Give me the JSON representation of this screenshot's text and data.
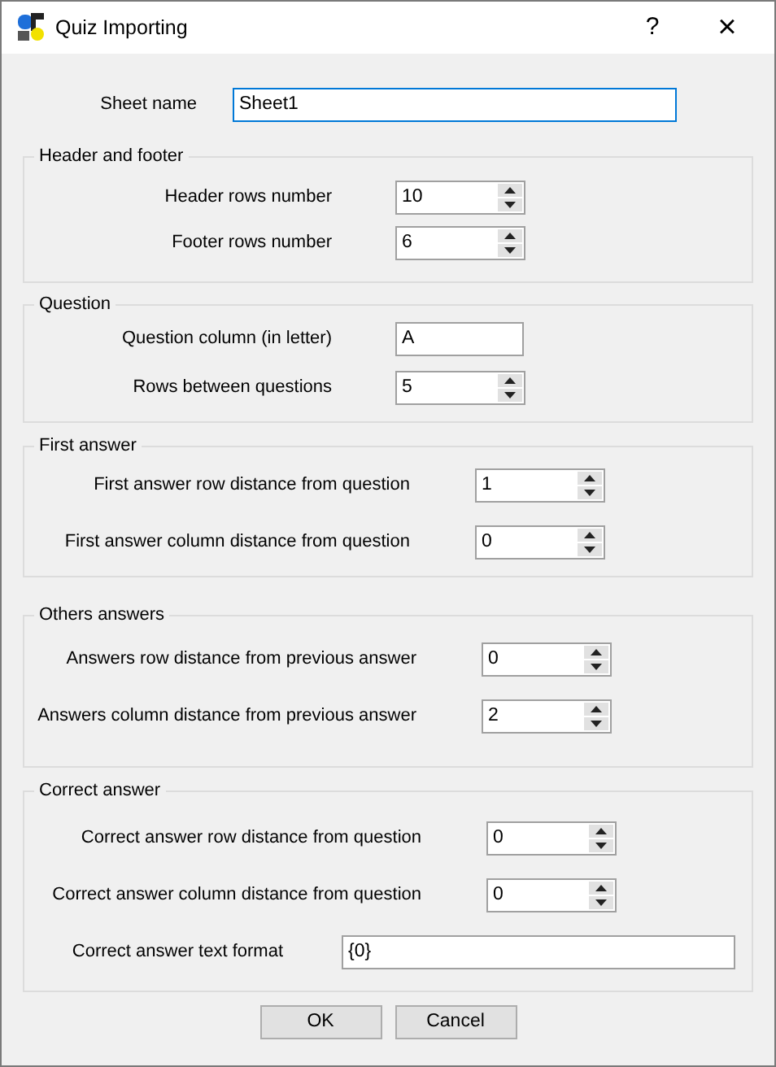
{
  "window": {
    "title": "Quiz Importing",
    "help": "?",
    "close": "×"
  },
  "sheet": {
    "label": "Sheet name",
    "value": "Sheet1",
    "focused": true
  },
  "groups": [
    {
      "title": "Header and footer",
      "fields": [
        {
          "kind": "spin",
          "label": "Header rows number",
          "value": "10"
        },
        {
          "kind": "spin",
          "label": "Footer rows number",
          "value": "6"
        }
      ]
    },
    {
      "title": "Question",
      "fields": [
        {
          "kind": "text",
          "label": "Question column (in letter)",
          "value": "A"
        },
        {
          "kind": "spin",
          "label": "Rows between questions",
          "value": "5"
        }
      ]
    },
    {
      "title": "First answer",
      "fields": [
        {
          "kind": "spin",
          "label": "First answer row distance from question",
          "value": "1"
        },
        {
          "kind": "spin",
          "label": "First answer column distance from question",
          "value": "0"
        }
      ]
    },
    {
      "title": "Others answers",
      "fields": [
        {
          "kind": "spin",
          "label": "Answers row distance from previous answer",
          "value": "0"
        },
        {
          "kind": "spin",
          "label": "Answers column distance from previous answer",
          "value": "2"
        }
      ]
    },
    {
      "title": "Correct answer",
      "fields": [
        {
          "kind": "spin",
          "label": "Correct answer row distance from question",
          "value": "0"
        },
        {
          "kind": "spin",
          "label": "Correct answer column distance from question",
          "value": "0"
        },
        {
          "kind": "wide",
          "label": "Correct answer text format",
          "value": "{0}"
        }
      ]
    }
  ],
  "buttons": [
    "OK",
    "Cancel"
  ]
}
